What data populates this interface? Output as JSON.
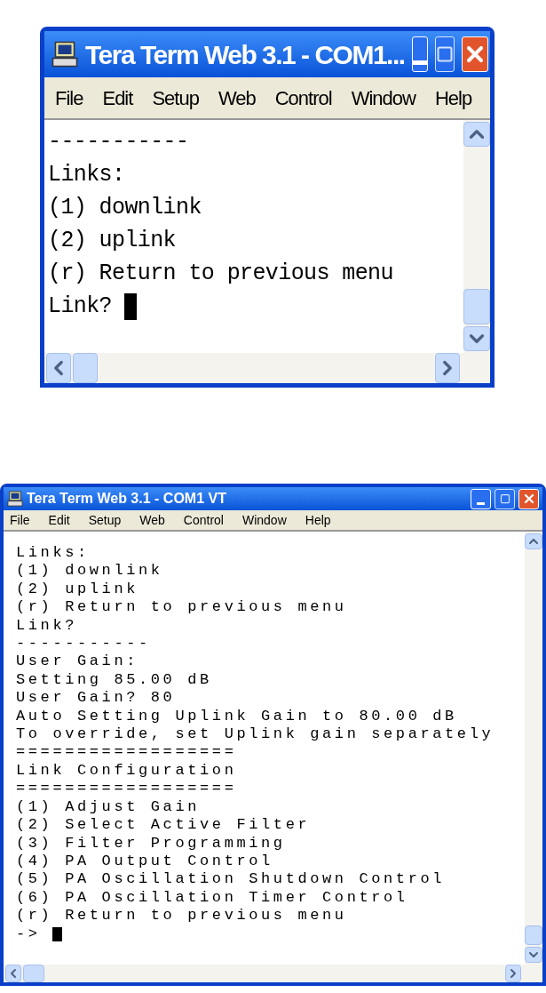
{
  "windows": [
    {
      "title": "Tera Term Web 3.1 - COM1...",
      "menu": [
        "File",
        "Edit",
        "Setup",
        "Web",
        "Control",
        "Window",
        "Help"
      ],
      "lines": [
        "-----------",
        "Links:",
        "(1) downlink",
        "(2) uplink",
        "(r) Return to previous menu",
        "Link? "
      ],
      "cursor": true
    },
    {
      "title": "Tera Term Web 3.1 - COM1 VT",
      "menu": [
        "File",
        "Edit",
        "Setup",
        "Web",
        "Control",
        "Window",
        "Help"
      ],
      "lines": [
        "Links:",
        "(1) downlink",
        "(2) uplink",
        "(r) Return to previous menu",
        "Link?",
        "-----------",
        "User Gain:",
        "Setting 85.00 dB",
        "User Gain? 80",
        "Auto Setting Uplink Gain to 80.00 dB",
        "To override, set Uplink gain separately",
        "==================",
        "Link Configuration",
        "==================",
        "(1) Adjust Gain",
        "(2) Select Active Filter",
        "(3) Filter Programming",
        "(4) PA Output Control",
        "(5) PA Oscillation Shutdown Control",
        "(6) PA Oscillation Timer Control",
        "(r) Return to previous menu",
        "-> "
      ],
      "cursor": true
    }
  ]
}
